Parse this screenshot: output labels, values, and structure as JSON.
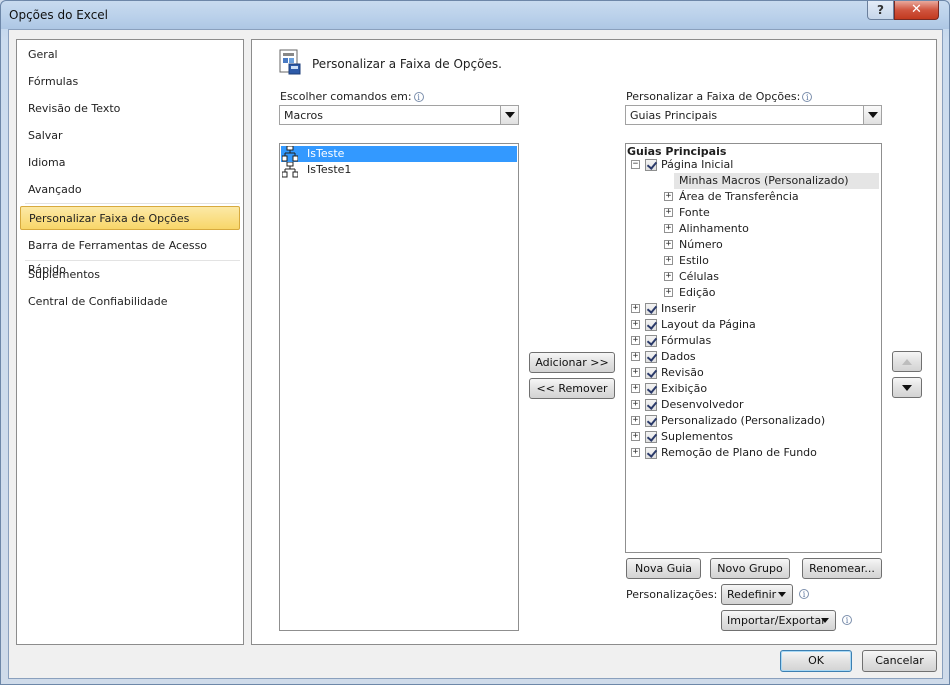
{
  "window": {
    "title": "Opções do Excel",
    "help_label": "?",
    "close_label": "✕"
  },
  "nav": {
    "items": [
      {
        "label": "Geral"
      },
      {
        "label": "Fórmulas"
      },
      {
        "label": "Revisão de Texto"
      },
      {
        "label": "Salvar"
      },
      {
        "label": "Idioma"
      },
      {
        "label": "Avançado"
      },
      {
        "label": "Personalizar Faixa de Opções",
        "selected": true
      },
      {
        "label": "Barra de Ferramentas de Acesso Rápido"
      },
      {
        "label": "Suplementos"
      },
      {
        "label": "Central de Confiabilidade"
      }
    ]
  },
  "panel": {
    "title": "Personalizar a Faixa de Opções.",
    "choose_label": "Escolher comandos em:",
    "choose_value": "Macros",
    "customize_label": "Personalizar a Faixa de Opções:",
    "customize_value": "Guias Principais",
    "info_glyph": "i"
  },
  "commands": [
    {
      "label": "IsTeste",
      "icon": "macro-icon",
      "selected": true
    },
    {
      "label": "IsTeste1",
      "icon": "macro-icon"
    }
  ],
  "middle_buttons": {
    "add": "Adicionar >>",
    "remove": "<< Remover"
  },
  "tree": {
    "header": "Guias Principais",
    "home": {
      "label": "Página Inicial",
      "expanded": true
    },
    "home_children": [
      {
        "label": "Minhas Macros (Personalizado)",
        "highlighted": true
      },
      {
        "label": "Área de Transferência"
      },
      {
        "label": "Fonte"
      },
      {
        "label": "Alinhamento"
      },
      {
        "label": "Número"
      },
      {
        "label": "Estilo"
      },
      {
        "label": "Células"
      },
      {
        "label": "Edição"
      }
    ],
    "tabs": [
      {
        "label": "Inserir"
      },
      {
        "label": "Layout da Página"
      },
      {
        "label": "Fórmulas"
      },
      {
        "label": "Dados"
      },
      {
        "label": "Revisão"
      },
      {
        "label": "Exibição"
      },
      {
        "label": "Desenvolvedor"
      },
      {
        "label": "Personalizado (Personalizado)"
      },
      {
        "label": "Suplementos"
      },
      {
        "label": "Remoção de Plano de Fundo"
      }
    ],
    "expand_glyph": "+",
    "collapse_glyph": "−"
  },
  "bottom": {
    "new_tab": "Nova Guia",
    "new_group": "Novo Grupo",
    "rename": "Renomear...",
    "customizations_label": "Personalizações:",
    "reset": "Redefinir",
    "import_export": "Importar/Exportar"
  },
  "footer": {
    "ok": "OK",
    "cancel": "Cancelar"
  }
}
